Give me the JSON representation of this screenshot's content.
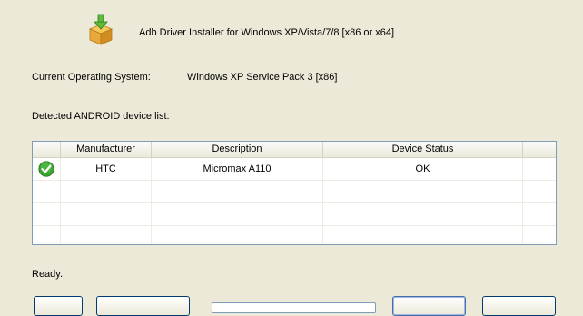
{
  "header": {
    "title": "Adb Driver Installer for Windows XP/Vista/7/8 [x86 or x64]",
    "icon": "package-install-icon"
  },
  "os": {
    "label": "Current Operating System:",
    "value": "Windows XP Service Pack 3 [x86]"
  },
  "device_list": {
    "label": "Detected ANDROID device list:",
    "columns": [
      "",
      "Manufacturer",
      "Description",
      "Device Status",
      ""
    ],
    "rows": [
      {
        "status_icon": "check-icon",
        "manufacturer": "HTC",
        "description": "Micromax A110",
        "device_status": "OK"
      }
    ]
  },
  "status": {
    "text": "Ready."
  },
  "colors": {
    "window_bg": "#ece9d8",
    "check_green": "#3aa531",
    "border_blue": "#7f9db9"
  }
}
